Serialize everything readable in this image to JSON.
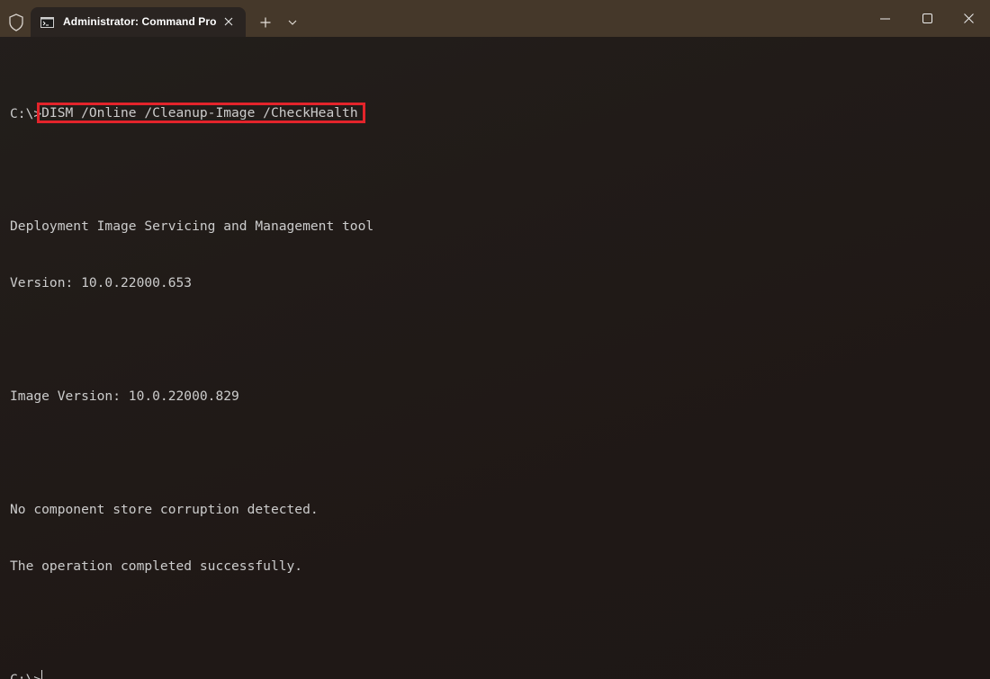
{
  "window": {
    "tab_title": "Administrator: Command Pro",
    "accent_color": "#e3242b",
    "titlebar_color": "#45382a"
  },
  "icons": {
    "shield": "shield-icon",
    "tab": "command-prompt-icon",
    "close_tab": "close-icon",
    "new_tab": "plus-icon",
    "dropdown": "chevron-down-icon",
    "minimize": "minimize-icon",
    "maximize": "maximize-icon",
    "close_window": "close-icon"
  },
  "terminal": {
    "prompt1": "C:\\>",
    "command": "DISM /Online /Cleanup-Image /CheckHealth",
    "output": [
      "Deployment Image Servicing and Management tool",
      "Version: 10.0.22000.653",
      "",
      "Image Version: 10.0.22000.829",
      "",
      "No component store corruption detected.",
      "The operation completed successfully."
    ],
    "prompt2": "C:\\>"
  }
}
